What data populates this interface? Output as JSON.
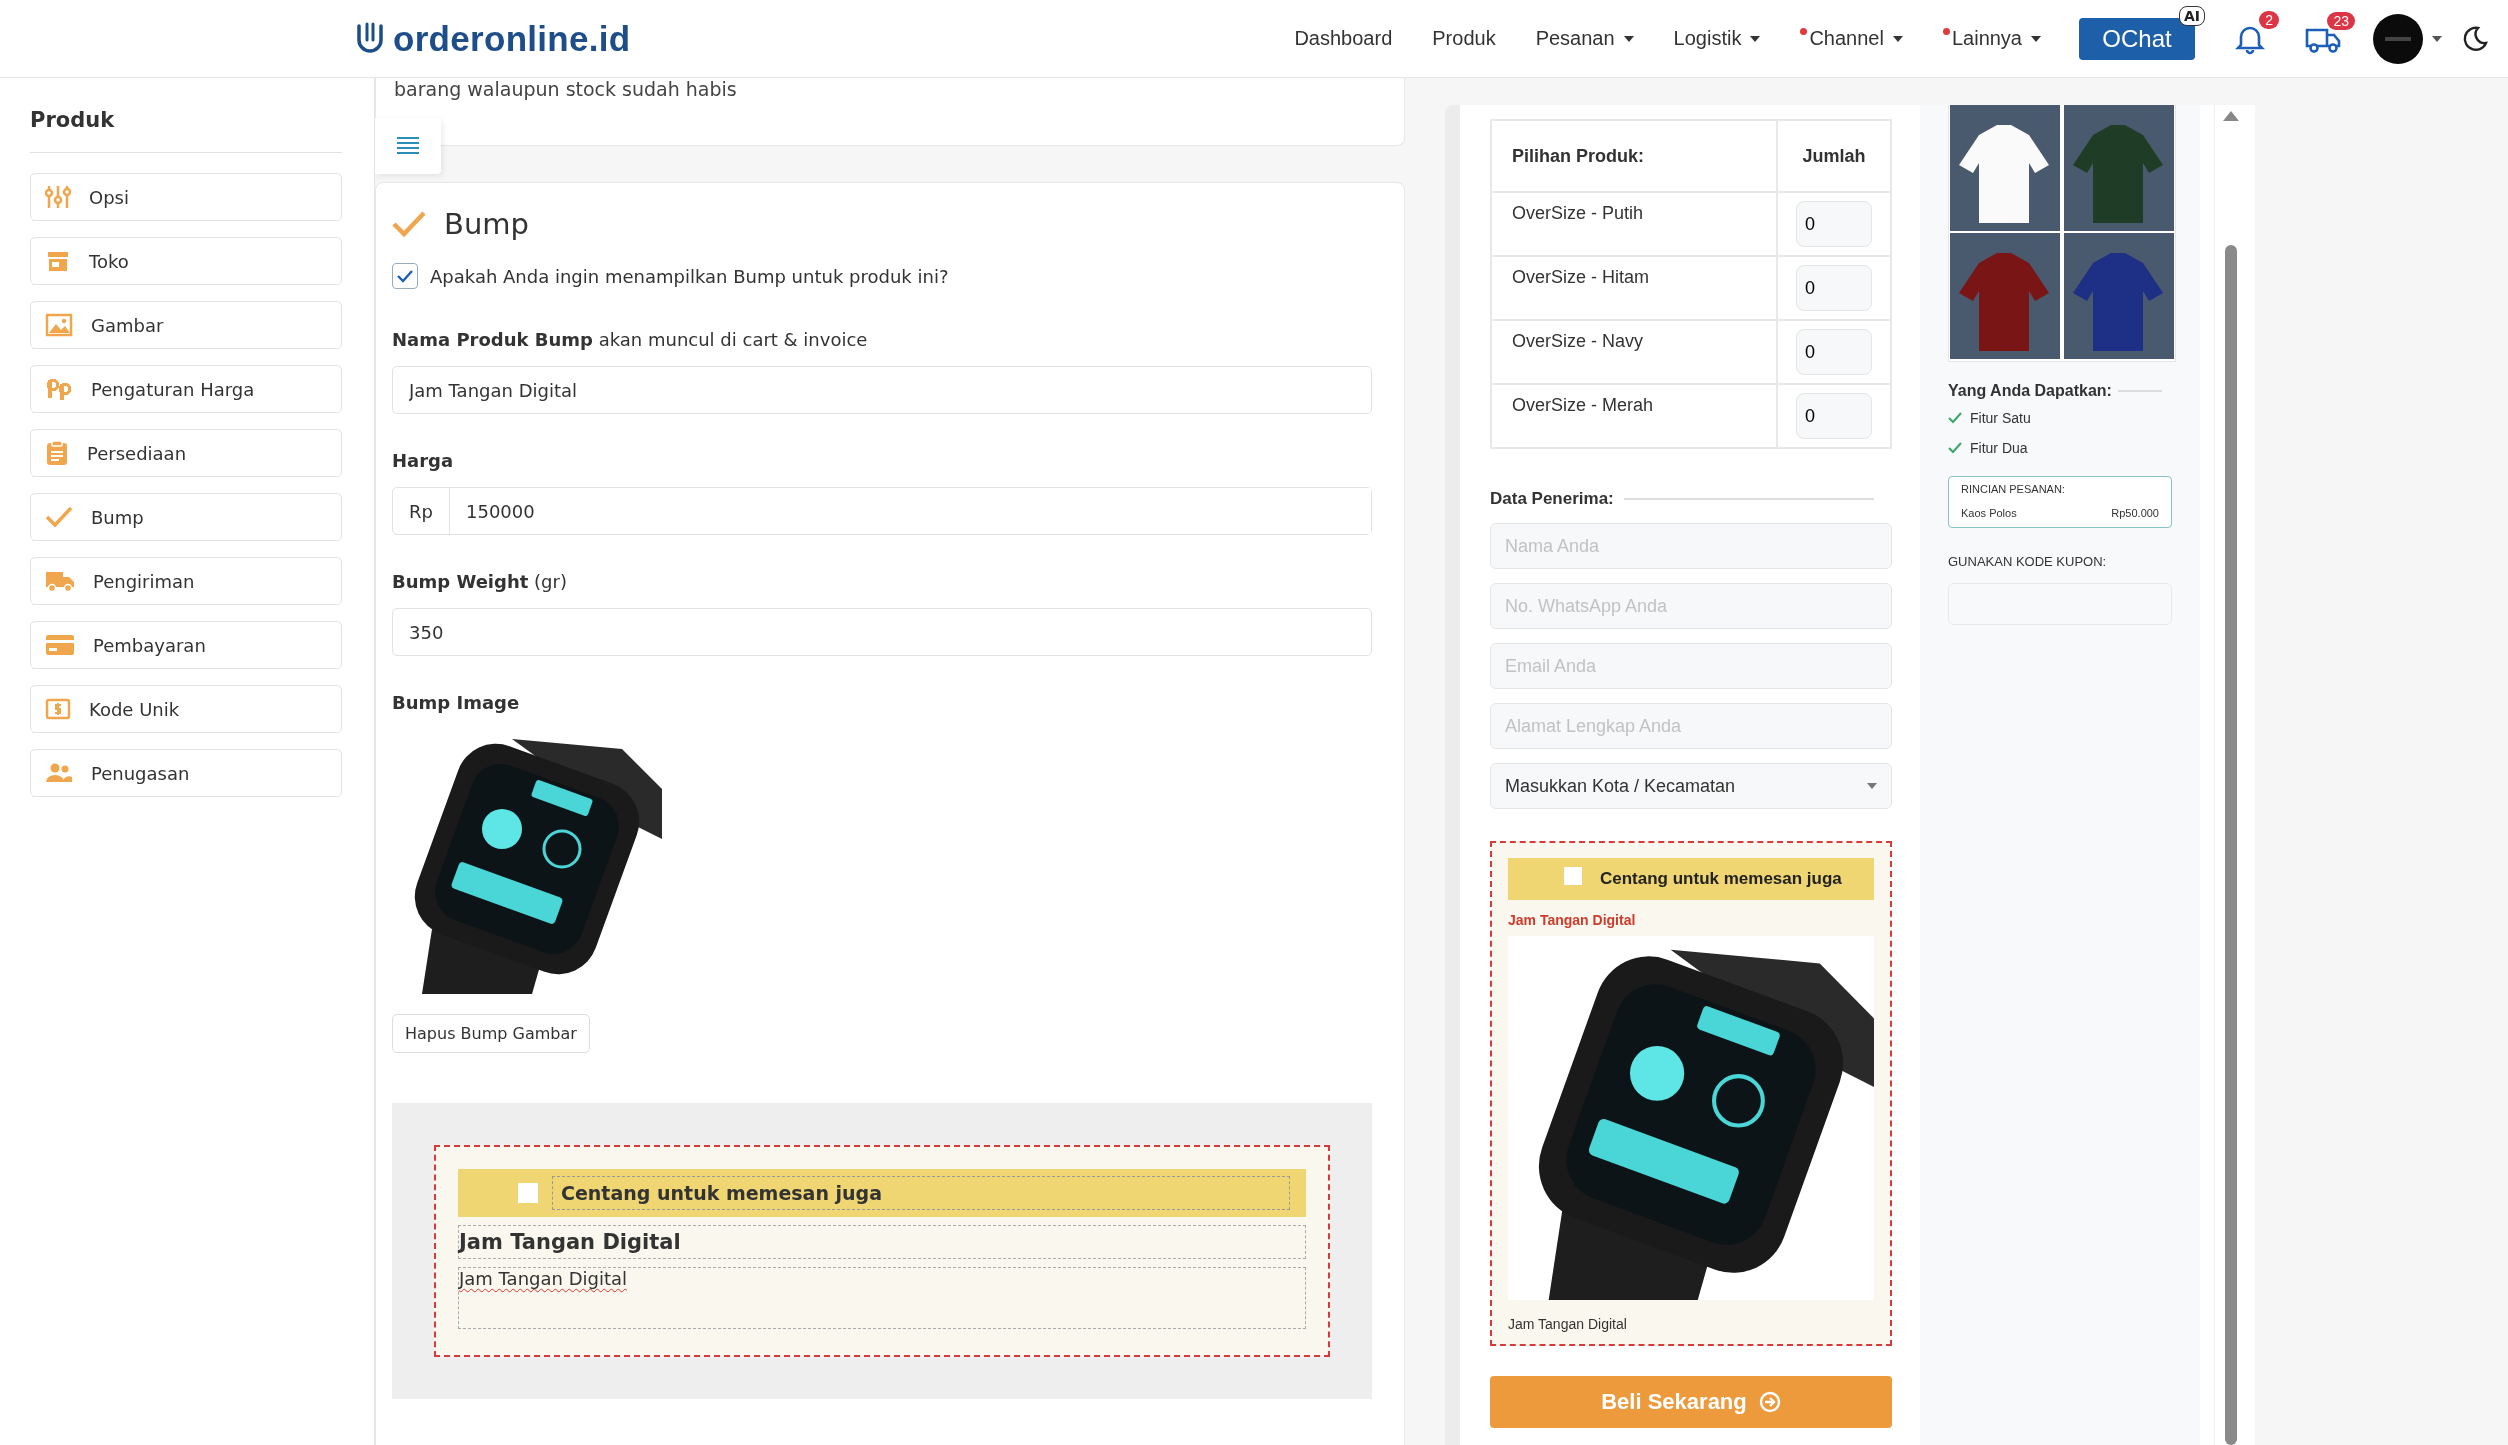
{
  "nav": {
    "logo": "orderonline.id",
    "links": [
      {
        "label": "Dashboard",
        "dropdown": false,
        "dot": false
      },
      {
        "label": "Produk",
        "dropdown": false,
        "dot": false
      },
      {
        "label": "Pesanan",
        "dropdown": true,
        "dot": false
      },
      {
        "label": "Logistik",
        "dropdown": true,
        "dot": false
      },
      {
        "label": "Channel",
        "dropdown": true,
        "dot": true
      },
      {
        "label": "Lainnya",
        "dropdown": true,
        "dot": true
      }
    ],
    "chat_button": "OChat",
    "chat_badge": "AI",
    "alerts": [
      {
        "kind": "bell",
        "count": "2"
      },
      {
        "kind": "truck",
        "count": "23"
      }
    ]
  },
  "sidebar": {
    "title": "Produk",
    "items": [
      "Opsi",
      "Toko",
      "Gambar",
      "Pengaturan Harga",
      "Persediaan",
      "Bump",
      "Pengiriman",
      "Pembayaran",
      "Kode Unik",
      "Penugasan"
    ]
  },
  "top_card": {
    "text": "barang walaupun stock sudah habis"
  },
  "bump_section": {
    "title": "Bump",
    "show_bump": {
      "label": "Apakah Anda ingin menampilkan Bump untuk produk ini?",
      "checked": true
    },
    "name_label": "**Nama Produk Bump** akan muncul di cart & invoice",
    "name_value": "Jam Tangan Digital",
    "price_label": "Harga",
    "price_prefix": "Rp",
    "price_value": "150000",
    "weight_label": "**Bump Weight** (gr)",
    "weight_value": "350",
    "image_label": "Bump Image",
    "remove_image_button": "Hapus Bump Gambar",
    "preview": {
      "checkbox_label": "Centang untuk memesan juga",
      "checked": false,
      "title": "Jam Tangan Digital",
      "description": "Jam Tangan Digital"
    }
  },
  "checkout_preview": {
    "table": {
      "columns": [
        "Pilihan Produk:",
        "Jumlah"
      ],
      "rows": [
        {
          "variant": "OverSize - Putih",
          "quantity": "0"
        },
        {
          "variant": "OverSize - Hitam",
          "quantity": "0"
        },
        {
          "variant": "OverSize - Navy",
          "quantity": "0"
        },
        {
          "variant": "OverSize - Merah",
          "quantity": "0"
        }
      ]
    },
    "recipient_title": "Data Penerima:",
    "fields": [
      {
        "placeholder": "Nama Anda"
      },
      {
        "placeholder": "No. WhatsApp Anda"
      },
      {
        "placeholder": "Email Anda"
      },
      {
        "placeholder": "Alamat Lengkap Anda"
      }
    ],
    "city_select": "Masukkan Kota / Kecamatan",
    "bump": {
      "checkbox_label": "Centang untuk memesan juga",
      "checked": false,
      "title": "Jam Tangan Digital",
      "caption": "Jam Tangan Digital"
    },
    "buy_button": "Beli Sekarang"
  },
  "product_info": {
    "benefits_title": "Yang Anda Dapatkan:",
    "benefits": [
      "Fitur Satu",
      "Fitur Dua"
    ],
    "order_summary": {
      "title": "RINCIAN PESANAN:",
      "items": [
        {
          "name": "Kaos Polos",
          "price": "Rp50.000"
        }
      ]
    },
    "coupon_label": "GUNAKAN KODE KUPON:"
  }
}
